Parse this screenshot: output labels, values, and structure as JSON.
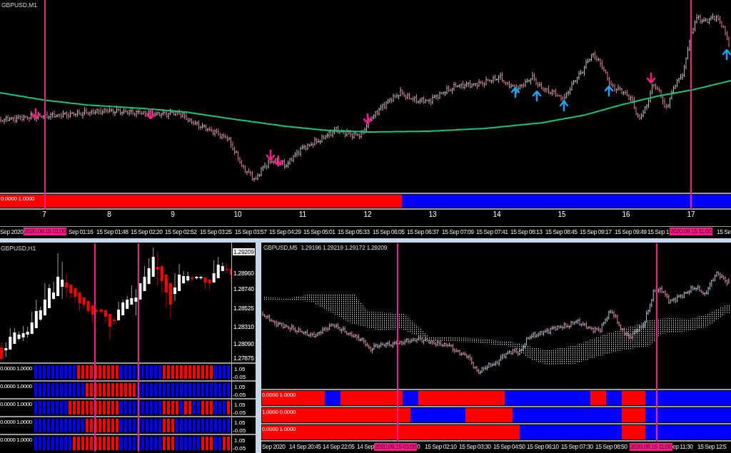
{
  "top_chart": {
    "title": "GBPUSD,M1",
    "indicator": {
      "label": "0.0000 1.0000",
      "bars": [
        {
          "color": "#ff0000"
        },
        {
          "color": "#ff0000"
        },
        {
          "color": "#ff0000"
        },
        {
          "color": "#ff0000"
        },
        {
          "color": "#ff0000"
        },
        {
          "color": "#ff0000"
        },
        {
          "color": "#ff0000"
        },
        {
          "color": "#ff0000"
        },
        {
          "color": "#ff0000"
        },
        {
          "color": "#ff0000"
        },
        {
          "color": "#ff0000"
        },
        {
          "color": "#ff0000"
        },
        {
          "color": "#ff0000"
        },
        {
          "color": "#ff0000"
        },
        {
          "color": "#ff0000"
        },
        {
          "color": "#ff0000"
        },
        {
          "color": "#ff0000"
        },
        {
          "color": "#ff0000"
        },
        {
          "color": "#ff0000"
        },
        {
          "color": "#ff0000"
        },
        {
          "color": "#ff0000"
        },
        {
          "color": "#ff0000"
        },
        {
          "color": "#0000ff"
        },
        {
          "color": "#0000ff"
        },
        {
          "color": "#0000ff"
        },
        {
          "color": "#0000ff"
        },
        {
          "color": "#0000ff"
        },
        {
          "color": "#0000ff"
        },
        {
          "color": "#0000ff"
        },
        {
          "color": "#0000ff"
        },
        {
          "color": "#0000ff"
        },
        {
          "color": "#0000ff"
        },
        {
          "color": "#0000ff"
        },
        {
          "color": "#0000ff"
        },
        {
          "color": "#0000ff"
        },
        {
          "color": "#0000ff"
        },
        {
          "color": "#0000ff"
        },
        {
          "color": "#0000ff"
        },
        {
          "color": "#0000ff"
        },
        {
          "color": "#0000ff"
        }
      ]
    },
    "index_axis": [
      "7",
      "8",
      "9",
      "10",
      "11",
      "12",
      "13",
      "14",
      "15",
      "16",
      "17"
    ],
    "time_axis": [
      {
        "kind": "tick",
        "label": "Sep 2020"
      },
      {
        "kind": "cursor",
        "label": "2020.09.15 01:00"
      },
      {
        "kind": "tick",
        "label": "Sep 01:16"
      },
      {
        "kind": "tick",
        "label": "15 Sep 01:48"
      },
      {
        "kind": "tick",
        "label": "15 Sep 02:20"
      },
      {
        "kind": "tick",
        "label": "15 Sep 02:52"
      },
      {
        "kind": "tick",
        "label": "15 Sep 03:25"
      },
      {
        "kind": "tick",
        "label": "15 Sep 03:57"
      },
      {
        "kind": "tick",
        "label": "15 Sep 04:29"
      },
      {
        "kind": "tick",
        "label": "15 Sep 05:01"
      },
      {
        "kind": "tick",
        "label": "15 Sep 05:33"
      },
      {
        "kind": "tick",
        "label": "15 Sep 06:05"
      },
      {
        "kind": "tick",
        "label": "15 Sep 06:37"
      },
      {
        "kind": "tick",
        "label": "15 Sep 07:09"
      },
      {
        "kind": "tick",
        "label": "15 Sep 07:41"
      },
      {
        "kind": "tick",
        "label": "15 Sep 08:13"
      },
      {
        "kind": "tick",
        "label": "15 Sep 08:45"
      },
      {
        "kind": "tick",
        "label": "15 Sep 09:17"
      },
      {
        "kind": "tick",
        "label": "15 Sep 09:49"
      },
      {
        "kind": "tick",
        "label": "15 Sep 1"
      },
      {
        "kind": "cursor",
        "label": "2020.09.15 11:00"
      },
      {
        "kind": "tick",
        "label": "15 Se"
      }
    ]
  },
  "h1_chart": {
    "title": "GBPUSD,H1",
    "price_scale": [
      {
        "kind": "current",
        "label": "1.29209"
      },
      {
        "kind": "tick",
        "label": "1.28960"
      },
      {
        "kind": "tick",
        "label": "1.28740"
      },
      {
        "kind": "tick",
        "label": "1.28525"
      },
      {
        "kind": "tick",
        "label": "1.28310"
      },
      {
        "kind": "tick",
        "label": "1.28090"
      },
      {
        "kind": "tick",
        "label": "1.27875"
      }
    ],
    "indicators": [
      {
        "label": "0.0000 1.0000",
        "scale_max": "1.05",
        "scale_min": "-0.05",
        "bars": [
          {
            "color": "#0000ff"
          },
          {
            "color": "#0000ff"
          },
          {
            "color": "#0000ff"
          },
          {
            "color": "#0000ff"
          },
          {
            "color": "#0000ff"
          },
          {
            "color": "#0000ff"
          },
          {
            "color": "#0000ff"
          },
          {
            "color": "#0000ff"
          },
          {
            "color": "#0000ff"
          },
          {
            "color": "#0000ff"
          },
          {
            "color": "#ff0000"
          },
          {
            "color": "#ff0000"
          },
          {
            "color": "#ff0000"
          },
          {
            "color": "#ff0000"
          },
          {
            "color": "#ff0000"
          },
          {
            "color": "#ff0000"
          },
          {
            "color": "#ff0000"
          },
          {
            "color": "#ff0000"
          },
          {
            "color": "#ff0000"
          },
          {
            "color": "#ff0000"
          },
          {
            "color": "#0000ff"
          },
          {
            "color": "#0000ff"
          },
          {
            "color": "#0000ff"
          },
          {
            "color": "#0000ff"
          },
          {
            "color": "#0000ff"
          },
          {
            "color": "#0000ff"
          },
          {
            "color": "#0000ff"
          },
          {
            "color": "#0000ff"
          },
          {
            "color": "#0000ff"
          },
          {
            "color": "#0000ff"
          },
          {
            "color": "#ff0000"
          },
          {
            "color": "#ff0000"
          },
          {
            "color": "#ff0000"
          },
          {
            "color": "#ff0000"
          },
          {
            "color": "#ff0000"
          },
          {
            "color": "#ff0000"
          },
          {
            "color": "#ff0000"
          },
          {
            "color": "#ff0000"
          },
          {
            "color": "#ff0000"
          },
          {
            "color": "#ff0000"
          },
          {
            "color": "#ff0000"
          },
          {
            "color": "#ff0000"
          },
          {
            "color": "#0000ff"
          },
          {
            "color": "#0000ff"
          },
          {
            "color": "#0000ff"
          },
          {
            "color": "#0000ff"
          }
        ]
      },
      {
        "label": "0.0000 1.0000",
        "scale_max": "1.05",
        "scale_min": "-0.05",
        "bars": [
          {
            "color": "#0000ff"
          },
          {
            "color": "#0000ff"
          },
          {
            "color": "#0000ff"
          },
          {
            "color": "#0000ff"
          },
          {
            "color": "#0000ff"
          },
          {
            "color": "#0000ff"
          },
          {
            "color": "#0000ff"
          },
          {
            "color": "#0000ff"
          },
          {
            "color": "#0000ff"
          },
          {
            "color": "#0000ff"
          },
          {
            "color": "#0000ff"
          },
          {
            "color": "#0000ff"
          },
          {
            "color": "#ff0000"
          },
          {
            "color": "#ff0000"
          },
          {
            "color": "#ff0000"
          },
          {
            "color": "#ff0000"
          },
          {
            "color": "#ff0000"
          },
          {
            "color": "#ff0000"
          },
          {
            "color": "#ff0000"
          },
          {
            "color": "#ff0000"
          },
          {
            "color": "#ff0000"
          },
          {
            "color": "#ff0000"
          },
          {
            "color": "#ff0000"
          },
          {
            "color": "#ff0000"
          },
          {
            "color": "#0000ff"
          },
          {
            "color": "#0000ff"
          },
          {
            "color": "#0000ff"
          },
          {
            "color": "#0000ff"
          },
          {
            "color": "#0000ff"
          },
          {
            "color": "#0000ff"
          },
          {
            "color": "#0000ff"
          },
          {
            "color": "#0000ff"
          },
          {
            "color": "#0000ff"
          },
          {
            "color": "#0000ff"
          },
          {
            "color": "#0000ff"
          },
          {
            "color": "#0000ff"
          },
          {
            "color": "#0000ff"
          },
          {
            "color": "#0000ff"
          },
          {
            "color": "#0000ff"
          },
          {
            "color": "#0000ff"
          },
          {
            "color": "#0000ff"
          },
          {
            "color": "#0000ff"
          },
          {
            "color": "#0000ff"
          },
          {
            "color": "#0000ff"
          },
          {
            "color": "#0000ff"
          },
          {
            "color": "#0000ff"
          }
        ]
      },
      {
        "label": "0.0000 1.0000",
        "scale_max": "1.05",
        "scale_min": "-0.05",
        "bars": [
          {
            "color": "#0000ff"
          },
          {
            "color": "#0000ff"
          },
          {
            "color": "#0000ff"
          },
          {
            "color": "#0000ff"
          },
          {
            "color": "#0000ff"
          },
          {
            "color": "#0000ff"
          },
          {
            "color": "#0000ff"
          },
          {
            "color": "#0000ff"
          },
          {
            "color": "#ff0000"
          },
          {
            "color": "#ff0000"
          },
          {
            "color": "#ff0000"
          },
          {
            "color": "#ff0000"
          },
          {
            "color": "#ff0000"
          },
          {
            "color": "#ff0000"
          },
          {
            "color": "#ff0000"
          },
          {
            "color": "#ff0000"
          },
          {
            "color": "#ff0000"
          },
          {
            "color": "#ff0000"
          },
          {
            "color": "#ff0000"
          },
          {
            "color": "#ff0000"
          },
          {
            "color": "#0000ff"
          },
          {
            "color": "#0000ff"
          },
          {
            "color": "#0000ff"
          },
          {
            "color": "#0000ff"
          },
          {
            "color": "#0000ff"
          },
          {
            "color": "#0000ff"
          },
          {
            "color": "#0000ff"
          },
          {
            "color": "#0000ff"
          },
          {
            "color": "#0000ff"
          },
          {
            "color": "#0000ff"
          },
          {
            "color": "#ff0000"
          },
          {
            "color": "#ff0000"
          },
          {
            "color": "#ff0000"
          },
          {
            "color": "#ff0000"
          },
          {
            "color": "#0000ff"
          },
          {
            "color": "#ff0000"
          },
          {
            "color": "#ff0000"
          },
          {
            "color": "#0000ff"
          },
          {
            "color": "#0000ff"
          },
          {
            "color": "#ff0000"
          },
          {
            "color": "#ff0000"
          },
          {
            "color": "#ff0000"
          },
          {
            "color": "#0000ff"
          },
          {
            "color": "#0000ff"
          },
          {
            "color": "#0000ff"
          },
          {
            "color": "#ff0000"
          }
        ]
      },
      {
        "label": "0.0000 1.0000",
        "scale_max": "1.05",
        "scale_min": "-0.05",
        "bars": [
          {
            "color": "#0000ff"
          },
          {
            "color": "#0000ff"
          },
          {
            "color": "#0000ff"
          },
          {
            "color": "#0000ff"
          },
          {
            "color": "#0000ff"
          },
          {
            "color": "#0000ff"
          },
          {
            "color": "#0000ff"
          },
          {
            "color": "#0000ff"
          },
          {
            "color": "#0000ff"
          },
          {
            "color": "#0000ff"
          },
          {
            "color": "#0000ff"
          },
          {
            "color": "#0000ff"
          },
          {
            "color": "#ff0000"
          },
          {
            "color": "#ff0000"
          },
          {
            "color": "#ff0000"
          },
          {
            "color": "#ff0000"
          },
          {
            "color": "#ff0000"
          },
          {
            "color": "#ff0000"
          },
          {
            "color": "#ff0000"
          },
          {
            "color": "#ff0000"
          },
          {
            "color": "#0000ff"
          },
          {
            "color": "#0000ff"
          },
          {
            "color": "#0000ff"
          },
          {
            "color": "#0000ff"
          },
          {
            "color": "#0000ff"
          },
          {
            "color": "#0000ff"
          },
          {
            "color": "#0000ff"
          },
          {
            "color": "#0000ff"
          },
          {
            "color": "#0000ff"
          },
          {
            "color": "#0000ff"
          },
          {
            "color": "#ff0000"
          },
          {
            "color": "#ff0000"
          },
          {
            "color": "#ff0000"
          },
          {
            "color": "#0000ff"
          },
          {
            "color": "#0000ff"
          },
          {
            "color": "#0000ff"
          },
          {
            "color": "#0000ff"
          },
          {
            "color": "#0000ff"
          },
          {
            "color": "#0000ff"
          },
          {
            "color": "#0000ff"
          },
          {
            "color": "#0000ff"
          },
          {
            "color": "#0000ff"
          },
          {
            "color": "#0000ff"
          },
          {
            "color": "#0000ff"
          },
          {
            "color": "#0000ff"
          },
          {
            "color": "#0000ff"
          }
        ]
      },
      {
        "label": "0.0000 1.0000",
        "scale_max": "1.05",
        "scale_min": "-0.05",
        "bars": [
          {
            "color": "#0000ff"
          },
          {
            "color": "#0000ff"
          },
          {
            "color": "#0000ff"
          },
          {
            "color": "#0000ff"
          },
          {
            "color": "#0000ff"
          },
          {
            "color": "#0000ff"
          },
          {
            "color": "#0000ff"
          },
          {
            "color": "#0000ff"
          },
          {
            "color": "#0000ff"
          },
          {
            "color": "#ff0000"
          },
          {
            "color": "#ff0000"
          },
          {
            "color": "#ff0000"
          },
          {
            "color": "#ff0000"
          },
          {
            "color": "#ff0000"
          },
          {
            "color": "#ff0000"
          },
          {
            "color": "#ff0000"
          },
          {
            "color": "#ff0000"
          },
          {
            "color": "#ff0000"
          },
          {
            "color": "#ff0000"
          },
          {
            "color": "#ff0000"
          },
          {
            "color": "#0000ff"
          },
          {
            "color": "#0000ff"
          },
          {
            "color": "#0000ff"
          },
          {
            "color": "#0000ff"
          },
          {
            "color": "#0000ff"
          },
          {
            "color": "#0000ff"
          },
          {
            "color": "#0000ff"
          },
          {
            "color": "#0000ff"
          },
          {
            "color": "#0000ff"
          },
          {
            "color": "#0000ff"
          },
          {
            "color": "#ff0000"
          },
          {
            "color": "#ff0000"
          },
          {
            "color": "#ff0000"
          },
          {
            "color": "#0000ff"
          },
          {
            "color": "#0000ff"
          },
          {
            "color": "#0000ff"
          },
          {
            "color": "#0000ff"
          },
          {
            "color": "#0000ff"
          },
          {
            "color": "#0000ff"
          },
          {
            "color": "#ff0000"
          },
          {
            "color": "#ff0000"
          },
          {
            "color": "#ff0000"
          },
          {
            "color": "#0000ff"
          },
          {
            "color": "#0000ff"
          },
          {
            "color": "#ff0000"
          },
          {
            "color": "#ff0000"
          }
        ]
      }
    ]
  },
  "m5_chart": {
    "title": "GBPUSD,M5",
    "quote": "1.29196 1.29219 1.29172 1.29209",
    "indicators": [
      {
        "label": "0.0000 1.0000",
        "bars": [
          {
            "color": "#ff0000"
          },
          {
            "color": "#ff0000"
          },
          {
            "color": "#ff0000"
          },
          {
            "color": "#ff0000"
          },
          {
            "color": "#ff0000"
          },
          {
            "color": "#ff0000"
          },
          {
            "color": "#ff0000"
          },
          {
            "color": "#ff0000"
          },
          {
            "color": "#0000ff"
          },
          {
            "color": "#0000ff"
          },
          {
            "color": "#ff0000"
          },
          {
            "color": "#ff0000"
          },
          {
            "color": "#ff0000"
          },
          {
            "color": "#ff0000"
          },
          {
            "color": "#ff0000"
          },
          {
            "color": "#ff0000"
          },
          {
            "color": "#ff0000"
          },
          {
            "color": "#ff0000"
          },
          {
            "color": "#0000ff"
          },
          {
            "color": "#0000ff"
          },
          {
            "color": "#ff0000"
          },
          {
            "color": "#ff0000"
          },
          {
            "color": "#ff0000"
          },
          {
            "color": "#ff0000"
          },
          {
            "color": "#ff0000"
          },
          {
            "color": "#ff0000"
          },
          {
            "color": "#ff0000"
          },
          {
            "color": "#ff0000"
          },
          {
            "color": "#ff0000"
          },
          {
            "color": "#ff0000"
          },
          {
            "color": "#ff0000"
          },
          {
            "color": "#0000ff"
          },
          {
            "color": "#0000ff"
          },
          {
            "color": "#0000ff"
          },
          {
            "color": "#0000ff"
          },
          {
            "color": "#0000ff"
          },
          {
            "color": "#0000ff"
          },
          {
            "color": "#0000ff"
          },
          {
            "color": "#0000ff"
          },
          {
            "color": "#0000ff"
          },
          {
            "color": "#0000ff"
          },
          {
            "color": "#0000ff"
          },
          {
            "color": "#ff0000"
          },
          {
            "color": "#ff0000"
          },
          {
            "color": "#0000ff"
          },
          {
            "color": "#0000ff"
          },
          {
            "color": "#ff0000"
          },
          {
            "color": "#ff0000"
          },
          {
            "color": "#ff0000"
          },
          {
            "color": "#0000ff"
          },
          {
            "color": "#0000ff"
          },
          {
            "color": "#0000ff"
          },
          {
            "color": "#0000ff"
          },
          {
            "color": "#0000ff"
          },
          {
            "color": "#0000ff"
          },
          {
            "color": "#0000ff"
          },
          {
            "color": "#0000ff"
          },
          {
            "color": "#0000ff"
          },
          {
            "color": "#0000ff"
          },
          {
            "color": "#0000ff"
          }
        ]
      },
      {
        "label": "1.0000 0.0000",
        "bars": [
          {
            "color": "#ff0000"
          },
          {
            "color": "#ff0000"
          },
          {
            "color": "#ff0000"
          },
          {
            "color": "#ff0000"
          },
          {
            "color": "#ff0000"
          },
          {
            "color": "#ff0000"
          },
          {
            "color": "#ff0000"
          },
          {
            "color": "#ff0000"
          },
          {
            "color": "#ff0000"
          },
          {
            "color": "#ff0000"
          },
          {
            "color": "#ff0000"
          },
          {
            "color": "#ff0000"
          },
          {
            "color": "#ff0000"
          },
          {
            "color": "#ff0000"
          },
          {
            "color": "#ff0000"
          },
          {
            "color": "#ff0000"
          },
          {
            "color": "#ff0000"
          },
          {
            "color": "#ff0000"
          },
          {
            "color": "#ff0000"
          },
          {
            "color": "#0000ff"
          },
          {
            "color": "#0000ff"
          },
          {
            "color": "#0000ff"
          },
          {
            "color": "#0000ff"
          },
          {
            "color": "#0000ff"
          },
          {
            "color": "#0000ff"
          },
          {
            "color": "#0000ff"
          },
          {
            "color": "#ff0000"
          },
          {
            "color": "#ff0000"
          },
          {
            "color": "#ff0000"
          },
          {
            "color": "#ff0000"
          },
          {
            "color": "#ff0000"
          },
          {
            "color": "#ff0000"
          },
          {
            "color": "#0000ff"
          },
          {
            "color": "#0000ff"
          },
          {
            "color": "#0000ff"
          },
          {
            "color": "#0000ff"
          },
          {
            "color": "#0000ff"
          },
          {
            "color": "#0000ff"
          },
          {
            "color": "#0000ff"
          },
          {
            "color": "#0000ff"
          },
          {
            "color": "#0000ff"
          },
          {
            "color": "#0000ff"
          },
          {
            "color": "#0000ff"
          },
          {
            "color": "#0000ff"
          },
          {
            "color": "#0000ff"
          },
          {
            "color": "#0000ff"
          },
          {
            "color": "#ff0000"
          },
          {
            "color": "#ff0000"
          },
          {
            "color": "#ff0000"
          },
          {
            "color": "#0000ff"
          },
          {
            "color": "#0000ff"
          },
          {
            "color": "#0000ff"
          },
          {
            "color": "#0000ff"
          },
          {
            "color": "#0000ff"
          },
          {
            "color": "#0000ff"
          },
          {
            "color": "#0000ff"
          },
          {
            "color": "#0000ff"
          },
          {
            "color": "#0000ff"
          },
          {
            "color": "#0000ff"
          },
          {
            "color": "#0000ff"
          }
        ]
      },
      {
        "label": "0.0000 1.0000",
        "bars": [
          {
            "color": "#ff0000"
          },
          {
            "color": "#ff0000"
          },
          {
            "color": "#ff0000"
          },
          {
            "color": "#ff0000"
          },
          {
            "color": "#ff0000"
          },
          {
            "color": "#ff0000"
          },
          {
            "color": "#ff0000"
          },
          {
            "color": "#ff0000"
          },
          {
            "color": "#ff0000"
          },
          {
            "color": "#ff0000"
          },
          {
            "color": "#ff0000"
          },
          {
            "color": "#ff0000"
          },
          {
            "color": "#ff0000"
          },
          {
            "color": "#ff0000"
          },
          {
            "color": "#ff0000"
          },
          {
            "color": "#ff0000"
          },
          {
            "color": "#ff0000"
          },
          {
            "color": "#ff0000"
          },
          {
            "color": "#ff0000"
          },
          {
            "color": "#ff0000"
          },
          {
            "color": "#ff0000"
          },
          {
            "color": "#ff0000"
          },
          {
            "color": "#ff0000"
          },
          {
            "color": "#ff0000"
          },
          {
            "color": "#ff0000"
          },
          {
            "color": "#ff0000"
          },
          {
            "color": "#ff0000"
          },
          {
            "color": "#ff0000"
          },
          {
            "color": "#ff0000"
          },
          {
            "color": "#ff0000"
          },
          {
            "color": "#ff0000"
          },
          {
            "color": "#ff0000"
          },
          {
            "color": "#ff0000"
          },
          {
            "color": "#0000ff"
          },
          {
            "color": "#0000ff"
          },
          {
            "color": "#0000ff"
          },
          {
            "color": "#0000ff"
          },
          {
            "color": "#0000ff"
          },
          {
            "color": "#0000ff"
          },
          {
            "color": "#0000ff"
          },
          {
            "color": "#0000ff"
          },
          {
            "color": "#0000ff"
          },
          {
            "color": "#0000ff"
          },
          {
            "color": "#0000ff"
          },
          {
            "color": "#0000ff"
          },
          {
            "color": "#0000ff"
          },
          {
            "color": "#ff0000"
          },
          {
            "color": "#ff0000"
          },
          {
            "color": "#ff0000"
          },
          {
            "color": "#0000ff"
          },
          {
            "color": "#0000ff"
          },
          {
            "color": "#0000ff"
          },
          {
            "color": "#0000ff"
          },
          {
            "color": "#0000ff"
          },
          {
            "color": "#0000ff"
          },
          {
            "color": "#0000ff"
          },
          {
            "color": "#0000ff"
          },
          {
            "color": "#0000ff"
          },
          {
            "color": "#0000ff"
          },
          {
            "color": "#0000ff"
          }
        ]
      }
    ],
    "time_axis": [
      {
        "kind": "tick",
        "label": "Sep 2020"
      },
      {
        "kind": "tick",
        "label": "14 Sep 20:45"
      },
      {
        "kind": "tick",
        "label": "14 Sep 22:05"
      },
      {
        "kind": "tick",
        "label": "14 Sep"
      },
      {
        "kind": "cursor",
        "label": "2020.09.15 01:00"
      },
      {
        "kind": "tick",
        "label": "0"
      },
      {
        "kind": "tick",
        "label": "15 Sep 02:10"
      },
      {
        "kind": "tick",
        "label": "15 Sep 03:30"
      },
      {
        "kind": "tick",
        "label": "15 Sep 04:50"
      },
      {
        "kind": "tick",
        "label": "15 Sep 06:10"
      },
      {
        "kind": "tick",
        "label": "15 Sep 07:30"
      },
      {
        "kind": "tick",
        "label": "15 Sep 08:50"
      },
      {
        "kind": "cursor",
        "label": "2020.09.15 11:00"
      },
      {
        "kind": "tick",
        "label": "ep 11:30"
      },
      {
        "kind": "tick",
        "label": "15 Sep 12:5"
      }
    ]
  }
}
